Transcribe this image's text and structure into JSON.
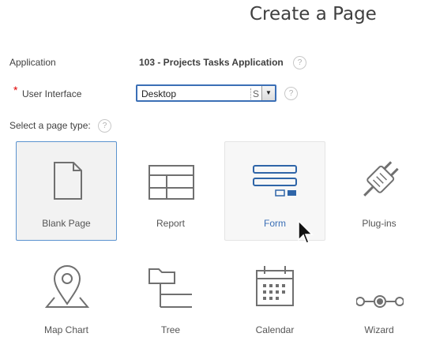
{
  "header": {
    "title": "Create a Page"
  },
  "form": {
    "application_label": "Application",
    "application_value": "103 - Projects Tasks Application",
    "help_glyph": "?",
    "required_marker": "*",
    "ui_label": "User Interface",
    "ui_value": "Desktop",
    "ui_truncated": "S",
    "page_type_label": "Select a page type:"
  },
  "page_types": [
    {
      "label": "Blank Page",
      "icon": "blank-page-icon",
      "selected": true
    },
    {
      "label": "Report",
      "icon": "report-icon"
    },
    {
      "label": "Form",
      "icon": "form-icon",
      "hovered": true
    },
    {
      "label": "Plug-ins",
      "icon": "plug-icon"
    },
    {
      "label": "Map Chart",
      "icon": "map-pin-icon"
    },
    {
      "label": "Tree",
      "icon": "tree-icon"
    },
    {
      "label": "Calendar",
      "icon": "calendar-icon"
    },
    {
      "label": "Wizard",
      "icon": "wizard-steps-icon"
    }
  ],
  "colors": {
    "accent": "#3b6fb6",
    "icon_gray": "#707070",
    "form_blue": "#2f65a8",
    "required": "#e00000"
  }
}
